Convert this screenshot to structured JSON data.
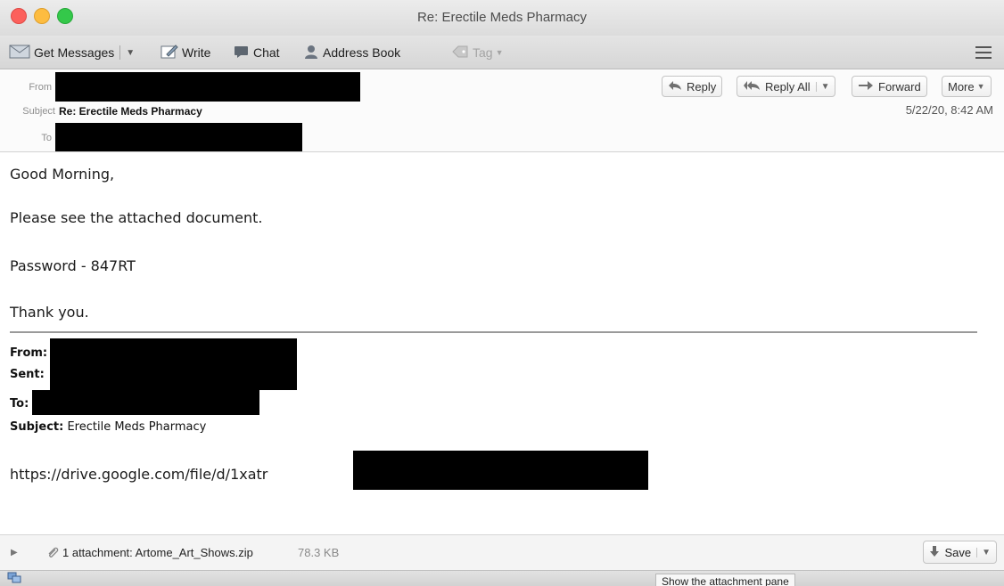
{
  "window": {
    "title": "Re: Erectile Meds Pharmacy"
  },
  "toolbar": {
    "get_messages": "Get Messages",
    "write": "Write",
    "chat": "Chat",
    "address_book": "Address Book",
    "tag": "Tag"
  },
  "header": {
    "from_label": "From",
    "subject_label": "Subject",
    "to_label": "To",
    "subject_value": "Re: Erectile Meds Pharmacy",
    "date": "5/22/20, 8:42 AM",
    "buttons": {
      "reply": "Reply",
      "reply_all": "Reply All",
      "forward": "Forward",
      "more": "More"
    }
  },
  "body": {
    "greeting": "Good Morning,",
    "line1": "Please see the attached document.",
    "line2": "Password - 847RT",
    "line3": "Thank you.",
    "quoted": {
      "from_label": "From:",
      "sent_label": "Sent:",
      "to_label": "To:",
      "subject_label": "Subject:",
      "subject_value": "Erectile Meds Pharmacy"
    },
    "link": "https://drive.google.com/file/d/1xatr"
  },
  "attachment": {
    "summary": "1 attachment: Artome_Art_Shows.zip",
    "size": "78.3 KB",
    "save": "Save"
  },
  "tooltip": "Show the attachment pane",
  "colors": {
    "close": "#fc605c",
    "minimize": "#fdbc40",
    "maximize": "#34c84a",
    "redaction": "#000000"
  }
}
